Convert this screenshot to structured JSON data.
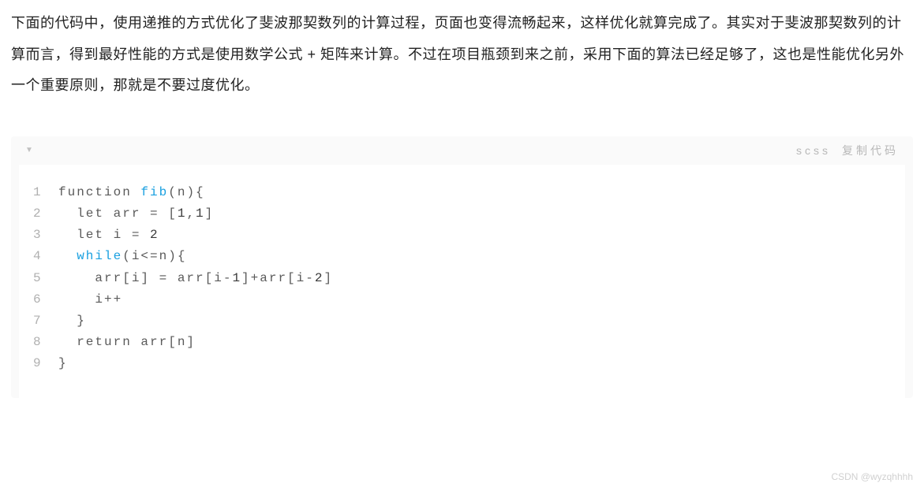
{
  "paragraph": "下面的代码中，使用递推的方式优化了斐波那契数列的计算过程，页面也变得流畅起来，这样优化就算完成了。其实对于斐波那契数列的计算而言，得到最好性能的方式是使用数学公式 + 矩阵来计算。不过在项目瓶颈到来之前，采用下面的算法已经足够了，这也是性能优化另外一个重要原则，那就是不要过度优化。",
  "code": {
    "lang": "scss",
    "copy_label": "复制代码",
    "lines": [
      {
        "n": "1",
        "parts": [
          {
            "t": "function ",
            "c": ""
          },
          {
            "t": "fib",
            "c": "identifier"
          },
          {
            "t": "(n){",
            "c": ""
          }
        ]
      },
      {
        "n": "2",
        "parts": [
          {
            "t": "  let arr = [",
            "c": ""
          },
          {
            "t": "1",
            "c": "number"
          },
          {
            "t": ",",
            "c": ""
          },
          {
            "t": "1",
            "c": "number"
          },
          {
            "t": "]",
            "c": ""
          }
        ]
      },
      {
        "n": "3",
        "parts": [
          {
            "t": "  let i = ",
            "c": ""
          },
          {
            "t": "2",
            "c": "number"
          },
          {
            "t": "",
            "c": ""
          }
        ]
      },
      {
        "n": "4",
        "parts": [
          {
            "t": "  ",
            "c": ""
          },
          {
            "t": "while",
            "c": "keyword"
          },
          {
            "t": "(i<=n){",
            "c": ""
          }
        ]
      },
      {
        "n": "5",
        "parts": [
          {
            "t": "    arr[i] = arr[i-",
            "c": ""
          },
          {
            "t": "1",
            "c": "number"
          },
          {
            "t": "]+arr[i-",
            "c": ""
          },
          {
            "t": "2",
            "c": "number"
          },
          {
            "t": "]",
            "c": ""
          }
        ]
      },
      {
        "n": "6",
        "parts": [
          {
            "t": "    i++",
            "c": ""
          }
        ]
      },
      {
        "n": "7",
        "parts": [
          {
            "t": "  }",
            "c": ""
          }
        ]
      },
      {
        "n": "8",
        "parts": [
          {
            "t": "  return arr[n]",
            "c": ""
          }
        ]
      },
      {
        "n": "9",
        "parts": [
          {
            "t": "}",
            "c": ""
          }
        ]
      }
    ]
  },
  "watermark": "CSDN @wyzqhhhh"
}
